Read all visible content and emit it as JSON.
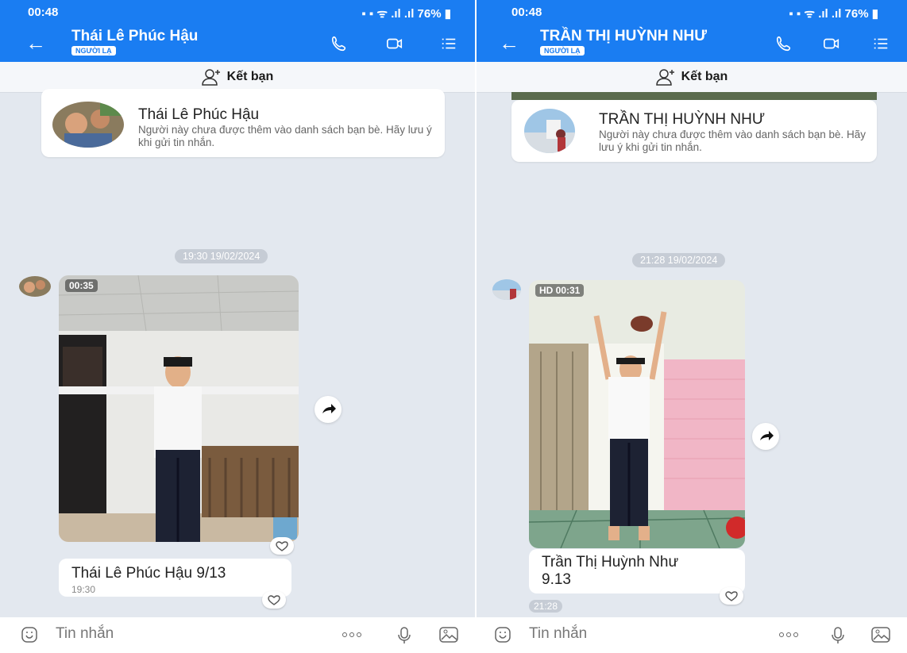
{
  "panels": [
    {
      "status": {
        "time": "00:48",
        "battery": "76%"
      },
      "header": {
        "name": "Thái Lê Phúc Hậu",
        "badge": "NGƯỜI LẠ"
      },
      "add_friend": "Kết bạn",
      "card": {
        "name": "Thái Lê Phúc Hậu",
        "note": "Người này chưa được thêm vào danh sách bạn bè. Hãy lưu ý khi gửi tin nhắn."
      },
      "timestamp": "19:30 19/02/2024",
      "video_duration": "00:35",
      "caption": "Thái Lê Phúc Hậu 9/13",
      "caption_time": "19:30",
      "input_placeholder": "Tin nhắn"
    },
    {
      "status": {
        "time": "00:48",
        "battery": "76%"
      },
      "header": {
        "name": "TRẦN THỊ HUỲNH NHƯ",
        "badge": "NGƯỜI LẠ"
      },
      "add_friend": "Kết bạn",
      "card": {
        "name": "TRẦN THỊ HUỲNH NHƯ",
        "note": "Người này chưa được thêm vào danh sách bạn bè. Hãy lưu ý khi gửi tin nhắn."
      },
      "timestamp": "21:28 19/02/2024",
      "video_duration": "HD 00:31",
      "caption_line1": "Trần Thị Huỳnh Như",
      "caption_line2": "9.13",
      "caption_time": "21:28",
      "input_placeholder": "Tin nhắn"
    }
  ],
  "colors": {
    "accent": "#1a7df2",
    "chat_bg": "#e3e8ef"
  },
  "icons": [
    "back-arrow-icon",
    "phone-icon",
    "video-call-icon",
    "list-menu-icon",
    "add-friend-icon",
    "share-icon",
    "heart-icon",
    "emoji-icon",
    "more-icon",
    "microphone-icon",
    "image-icon"
  ]
}
